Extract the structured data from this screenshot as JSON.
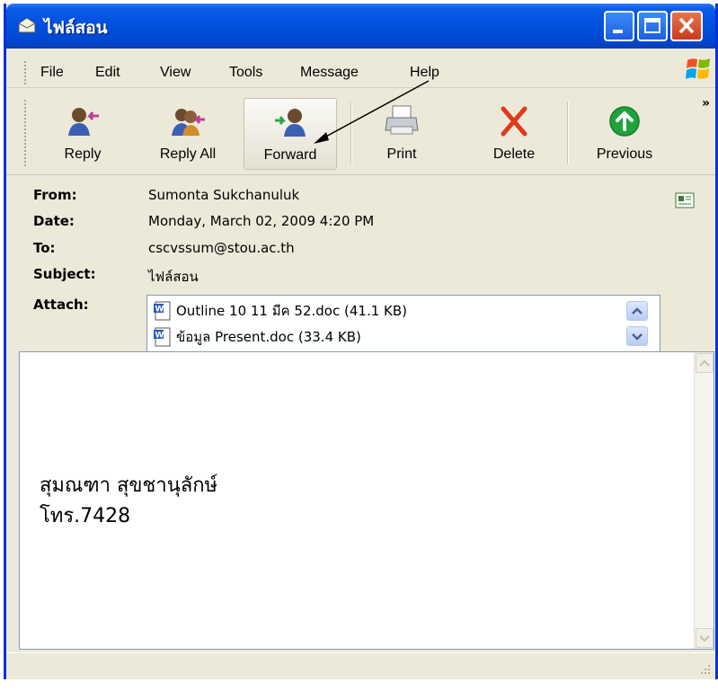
{
  "window": {
    "title": "ไฟล์สอน"
  },
  "menu": [
    "File",
    "Edit",
    "View",
    "Tools",
    "Message",
    "Help"
  ],
  "toolbar": {
    "buttons": [
      {
        "label": "Reply",
        "icon": "reply-icon"
      },
      {
        "label": "Reply All",
        "icon": "reply-all-icon"
      },
      {
        "label": "Forward",
        "icon": "forward-icon"
      },
      {
        "label": "Print",
        "icon": "print-icon"
      },
      {
        "label": "Delete",
        "icon": "delete-icon"
      },
      {
        "label": "Previous",
        "icon": "previous-icon"
      }
    ],
    "more": "»"
  },
  "header": {
    "from_label": "From:",
    "from_value": "Sumonta Sukchanuluk",
    "date_label": "Date:",
    "date_value": "Monday, March 02, 2009 4:20 PM",
    "to_label": "To:",
    "to_value": "cscvssum@stou.ac.th",
    "subject_label": "Subject:",
    "subject_value": "ไฟล์สอน",
    "attach_label": "Attach:",
    "attachments": [
      "Outline 10 11 มีค 52.doc (41.1 KB)",
      "ข้อมูล Present.doc (33.4 KB)"
    ]
  },
  "body": {
    "lines": [
      "สุมณฑา  สุขชานุลักษ์",
      "โทร.7428"
    ]
  },
  "colors": {
    "titlebar": "#0050DE",
    "chrome": "#ECE9D8",
    "delete_red": "#E0391E",
    "previous_green": "#1FA33A"
  }
}
